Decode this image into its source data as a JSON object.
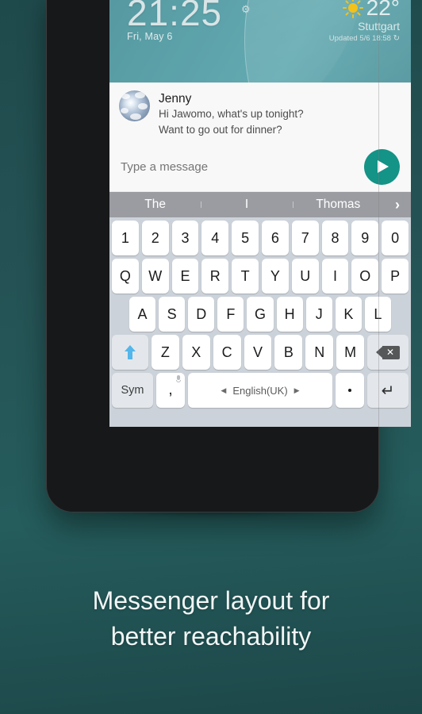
{
  "lockscreen": {
    "time": "21:25",
    "gear_icon": "gear-icon",
    "date": "Fri, May 6",
    "weather": {
      "sun_icon": "sun-icon",
      "temperature": "22°",
      "city": "Stuttgart",
      "updated": "Updated 5/6 18:58",
      "refresh_icon": "↻"
    }
  },
  "conversation": {
    "avatar_name": "jenny-avatar",
    "sender": "Jenny",
    "line1": "Hi Jawomo, what's up tonight?",
    "line2": "Want to go out for dinner?",
    "compose_placeholder": "Type a message",
    "compose_value": "",
    "send_icon": "send-icon"
  },
  "suggestions": {
    "items": [
      "The",
      "I",
      "Thomas"
    ],
    "more_icon": "›"
  },
  "keyboard": {
    "row_digits": [
      "1",
      "2",
      "3",
      "4",
      "5",
      "6",
      "7",
      "8",
      "9",
      "0"
    ],
    "row_qwerty": [
      "Q",
      "W",
      "E",
      "R",
      "T",
      "Y",
      "U",
      "I",
      "O",
      "P"
    ],
    "row_home": [
      "A",
      "S",
      "D",
      "F",
      "G",
      "H",
      "J",
      "K",
      "L"
    ],
    "row_bottom": [
      "Z",
      "X",
      "C",
      "V",
      "B",
      "N",
      "M"
    ],
    "shift_label": "shift-icon",
    "backspace_label": "backspace-icon",
    "sym_label": "Sym",
    "comma_label": ",",
    "mic_label": "mic-icon",
    "space_label": "English(UK)",
    "space_prev_icon": "◀",
    "space_next_icon": "▶",
    "period_label": ".",
    "enter_label": "↵"
  },
  "caption": {
    "line1": "Messenger layout for",
    "line2": "better reachability"
  },
  "colors": {
    "background": "#255355",
    "send_button": "#149387",
    "suggestion_bar": "#9a9ca1",
    "keyboard_bg": "#ccd2d9",
    "key_face": "#ffffff",
    "fn_key_face": "#e3e7eb",
    "shift_arrow": "#54b6ea",
    "sun": "#f2c21a"
  }
}
